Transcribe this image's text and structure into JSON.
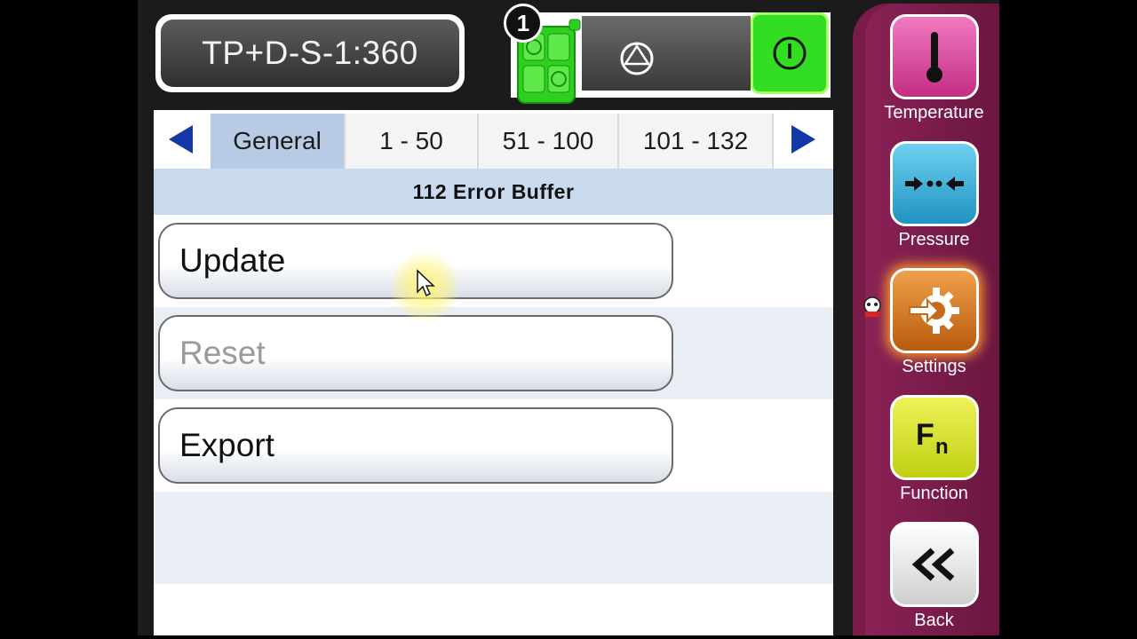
{
  "header": {
    "device_name": "TP+D-S-1:360",
    "unit_number": "1",
    "colors": {
      "power_on": "#33dd22",
      "nav_background": "#7a1c4a"
    }
  },
  "tabs": {
    "items": [
      {
        "label": "General",
        "active": true
      },
      {
        "label": "1 - 50",
        "active": false
      },
      {
        "label": "51 - 100",
        "active": false
      },
      {
        "label": "101 - 132",
        "active": false
      }
    ]
  },
  "content": {
    "title": "112 Error Buffer",
    "buttons": [
      {
        "label": "Update",
        "enabled": true
      },
      {
        "label": "Reset",
        "enabled": false
      },
      {
        "label": "Export",
        "enabled": true
      }
    ]
  },
  "nav": {
    "items": [
      {
        "label": "Temperature",
        "icon": "thermometer-icon",
        "color": "#d8449a"
      },
      {
        "label": "Pressure",
        "icon": "pressure-arrows-icon",
        "color": "#28a9d4"
      },
      {
        "label": "Settings",
        "icon": "gear-arrow-icon",
        "color": "#e07a1a",
        "active": true
      },
      {
        "label": "Function",
        "icon": "fn-icon",
        "color": "#d4e21a"
      },
      {
        "label": "Back",
        "icon": "double-chevron-left-icon",
        "color": "#e8e8e8"
      }
    ]
  }
}
